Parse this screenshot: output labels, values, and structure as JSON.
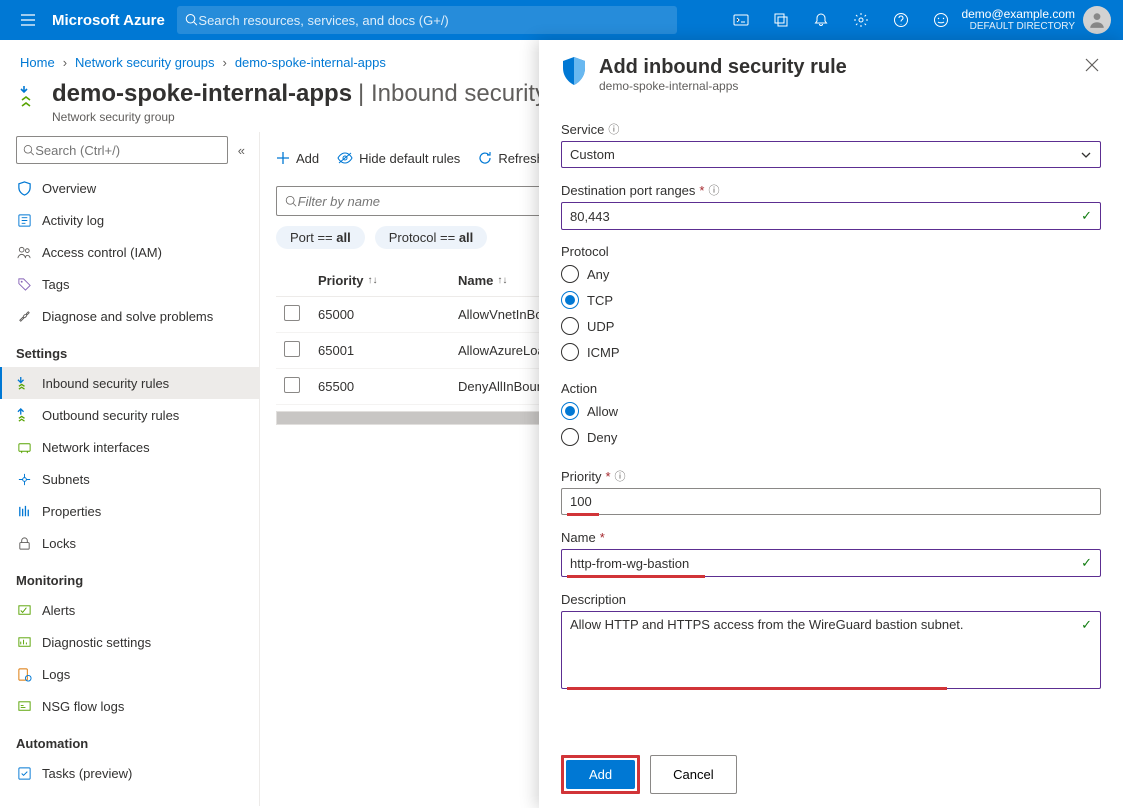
{
  "topbar": {
    "brand": "Microsoft Azure",
    "search_placeholder": "Search resources, services, and docs (G+/)",
    "account_email": "demo@example.com",
    "account_directory": "DEFAULT DIRECTORY"
  },
  "breadcrumb": {
    "items": [
      "Home",
      "Network security groups",
      "demo-spoke-internal-apps"
    ]
  },
  "header": {
    "resource_name": "demo-spoke-internal-apps",
    "blade_name": "Inbound security rules",
    "resource_type": "Network security group"
  },
  "sidebar": {
    "search_placeholder": "Search (Ctrl+/)",
    "items": [
      {
        "label": "Overview",
        "icon": "shield"
      },
      {
        "label": "Activity log",
        "icon": "log"
      },
      {
        "label": "Access control (IAM)",
        "icon": "people"
      },
      {
        "label": "Tags",
        "icon": "tag"
      },
      {
        "label": "Diagnose and solve problems",
        "icon": "wrench"
      }
    ],
    "settings_label": "Settings",
    "settings_items": [
      {
        "label": "Inbound security rules",
        "icon": "inbound",
        "active": true
      },
      {
        "label": "Outbound security rules",
        "icon": "outbound"
      },
      {
        "label": "Network interfaces",
        "icon": "nic"
      },
      {
        "label": "Subnets",
        "icon": "subnet"
      },
      {
        "label": "Properties",
        "icon": "props"
      },
      {
        "label": "Locks",
        "icon": "lock"
      }
    ],
    "monitoring_label": "Monitoring",
    "monitoring_items": [
      {
        "label": "Alerts",
        "icon": "alert"
      },
      {
        "label": "Diagnostic settings",
        "icon": "diag"
      },
      {
        "label": "Logs",
        "icon": "logs"
      },
      {
        "label": "NSG flow logs",
        "icon": "flow"
      }
    ],
    "automation_label": "Automation",
    "automation_items": [
      {
        "label": "Tasks (preview)",
        "icon": "tasks"
      }
    ]
  },
  "toolbar": {
    "add": "Add",
    "hide_default": "Hide default rules",
    "refresh": "Refresh"
  },
  "filter": {
    "placeholder": "Filter by name",
    "pill_port": "Port == all",
    "pill_protocol": "Protocol == all"
  },
  "table": {
    "col_priority": "Priority",
    "col_name": "Name",
    "rows": [
      {
        "priority": "65000",
        "name": "AllowVnetInBound"
      },
      {
        "priority": "65001",
        "name": "AllowAzureLoadBalancerInBound"
      },
      {
        "priority": "65500",
        "name": "DenyAllInBound"
      }
    ]
  },
  "panel": {
    "title": "Add inbound security rule",
    "subtitle": "demo-spoke-internal-apps",
    "service_label": "Service",
    "service_value": "Custom",
    "dest_port_label": "Destination port ranges",
    "dest_port_value": "80,443",
    "protocol_label": "Protocol",
    "protocol_options": [
      "Any",
      "TCP",
      "UDP",
      "ICMP"
    ],
    "protocol_selected": "TCP",
    "action_label": "Action",
    "action_options": [
      "Allow",
      "Deny"
    ],
    "action_selected": "Allow",
    "priority_label": "Priority",
    "priority_value": "100",
    "name_label": "Name",
    "name_value": "http-from-wg-bastion",
    "description_label": "Description",
    "description_value": "Allow HTTP and HTTPS access from the WireGuard bastion subnet.",
    "add_button": "Add",
    "cancel_button": "Cancel"
  }
}
